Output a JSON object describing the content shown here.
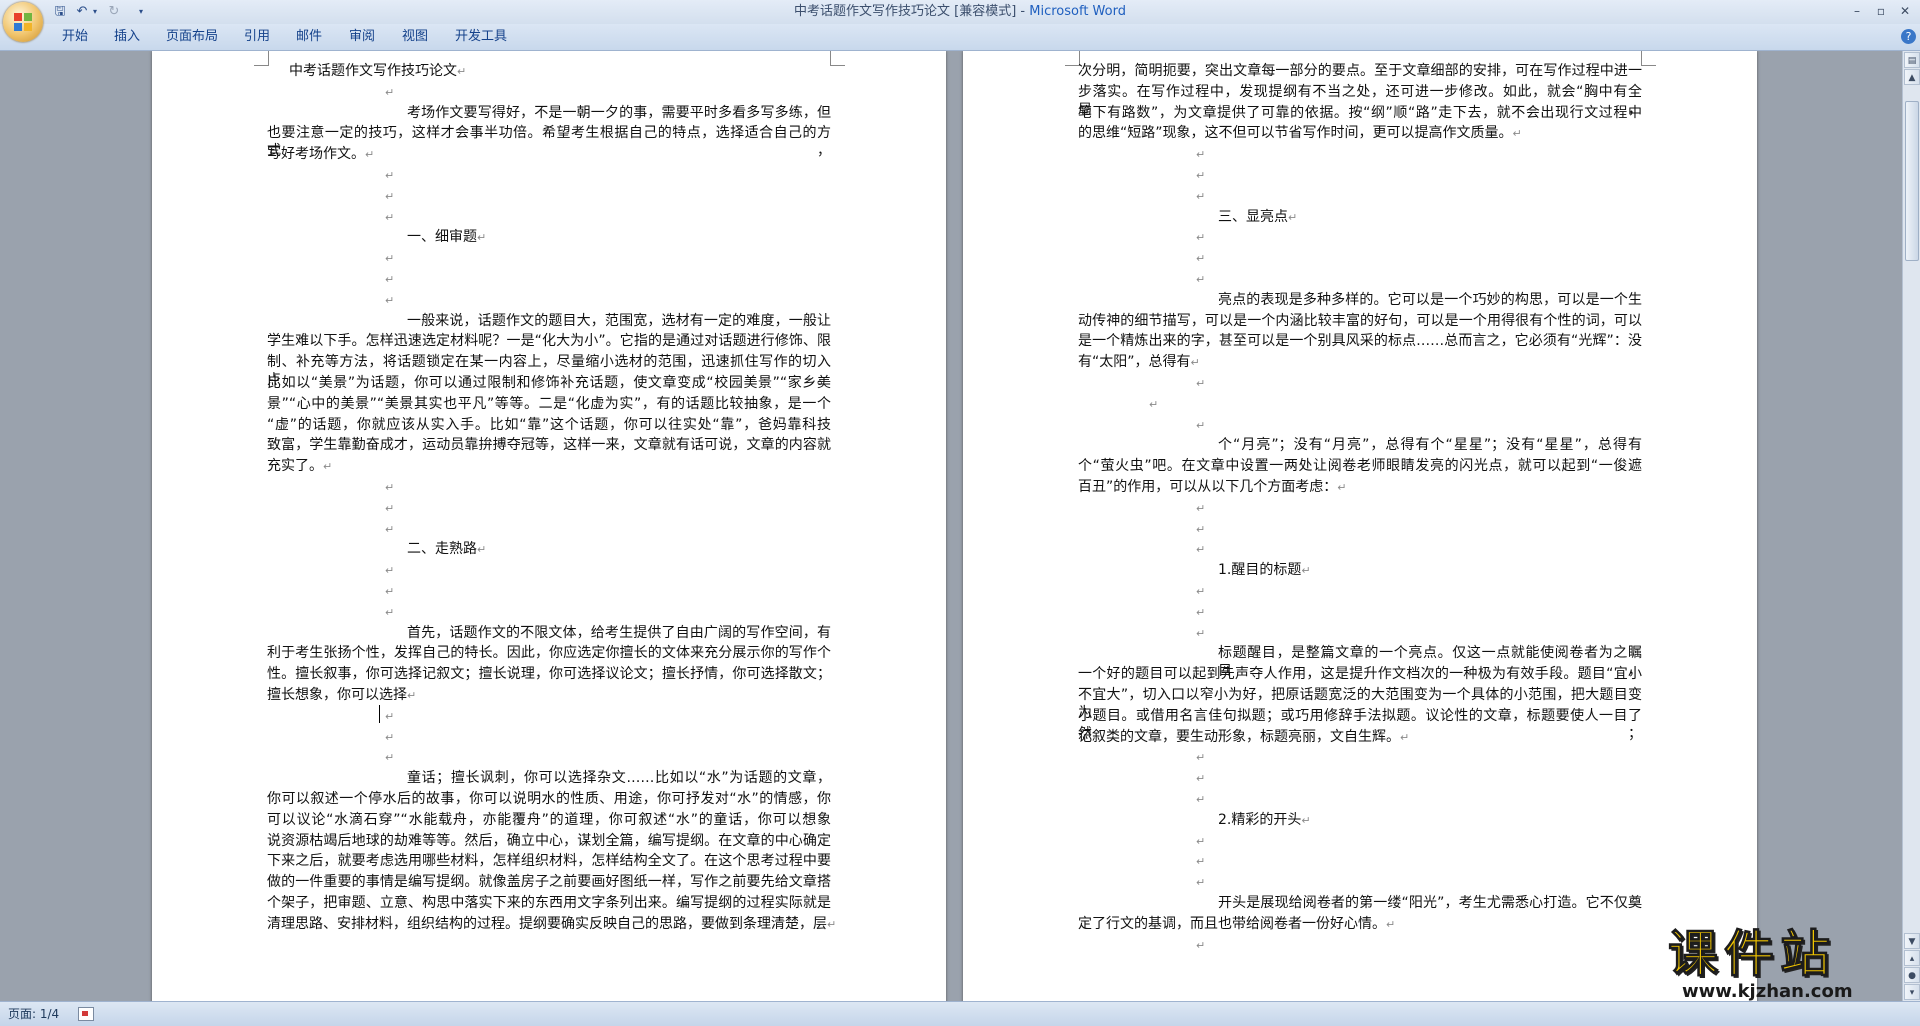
{
  "window": {
    "title_doc": "中考话题作文写作技巧论文 [兼容模式]",
    "title_separator": " - ",
    "title_app": "Microsoft Word"
  },
  "quick_access": {
    "icons": [
      "save-icon",
      "undo-icon",
      "undo-dropdown-icon",
      "redo-icon",
      "customize-qat-icon"
    ]
  },
  "ribbon": {
    "tabs": [
      "开始",
      "插入",
      "页面布局",
      "引用",
      "邮件",
      "审阅",
      "视图",
      "开发工具"
    ]
  },
  "pilcrow": "↵",
  "left_page": [
    {
      "type": "title",
      "text": "中考话题作文写作技巧论文"
    },
    {
      "type": "empty"
    },
    {
      "type": "para",
      "lines": [
        "考场作文要写得好，不是一朝一夕的事，需要平时多看多写多练，但",
        "也要注意一定的技巧，这样才会事半功倍。希望考生根据自己的特点，选择适合自己的方式，",
        "写好考场作文。"
      ]
    },
    {
      "type": "empty"
    },
    {
      "type": "empty"
    },
    {
      "type": "empty"
    },
    {
      "type": "heading",
      "text": "一、细审题"
    },
    {
      "type": "empty"
    },
    {
      "type": "empty"
    },
    {
      "type": "empty"
    },
    {
      "type": "para",
      "lines": [
        "一般来说，话题作文的题目大，范围宽，选材有一定的难度，一般让",
        "学生难以下手。怎样迅速选定材料呢？一是“化大为小”。它指的是通过对话题进行修饰、限",
        "制、补充等方法，将话题锁定在某一内容上，尽量缩小选材的范围，迅速抓住写作的切入点。",
        "比如以“美景”为话题，你可以通过限制和修饰补充话题，使文章变成“校园美景”“家乡美",
        "景”“心中的美景”“美景其实也平凡”等等。二是“化虚为实”，有的话题比较抽象，是一个",
        "“虚”的话题，你就应该从实入手。比如“靠”这个话题，你可以往实处“靠”，爸妈靠科技",
        "致富，学生靠勤奋成才，运动员靠拚搏夺冠等，这样一来，文章就有话可说，文章的内容就",
        "充实了。"
      ]
    },
    {
      "type": "empty"
    },
    {
      "type": "empty"
    },
    {
      "type": "empty"
    },
    {
      "type": "heading",
      "text": "二、走熟路"
    },
    {
      "type": "empty"
    },
    {
      "type": "empty"
    },
    {
      "type": "empty"
    },
    {
      "type": "para",
      "lines": [
        "首先，话题作文的不限文体，给考生提供了自由广阔的写作空间，有",
        "利于考生张扬个性，发挥自己的特长。因此，你应选定你擅长的文体来充分展示你的写作个",
        "性。擅长叙事，你可选择记叙文；擅长说理，你可选择议论文；擅长抒情，你可选择散文；",
        "擅长想象，你可以选择"
      ]
    },
    {
      "type": "empty",
      "cursor": true
    },
    {
      "type": "empty"
    },
    {
      "type": "empty"
    },
    {
      "type": "para",
      "lines": [
        "童话；擅长讽刺，你可以选择杂文……比如以“水”为话题的文章，",
        "你可以叙述一个停水后的故事，你可以说明水的性质、用途，你可抒发对“水”的情感，你",
        "可以议论“水滴石穿”“水能载舟，亦能覆舟”的道理，你可叙述“水”的童话，你可以想象",
        "说资源枯竭后地球的劫难等等。然后，确立中心，谋划全篇，编写提纲。在文章的中心确定",
        "下来之后，就要考虑选用哪些材料，怎样组织材料，怎样结构全文了。在这个思考过程中要",
        "做的一件重要的事情是编写提纲。就像盖房子之前要画好图纸一样，写作之前要先给文章搭",
        "个架子，把审题、立意、构思中落实下来的东西用文字条列出来。编写提纲的过程实际就是",
        "清理思路、安排材料，组织结构的过程。提纲要确实反映自己的思路，要做到条理清楚，层"
      ]
    }
  ],
  "right_page": [
    {
      "type": "para",
      "cont": true,
      "lines": [
        "次分明，简明扼要，突出文章每一部分的要点。至于文章细部的安排，可在写作过程中进一",
        "步落实。在写作过程中，发现提纲有不当之处，还可进一步修改。如此，就会“胸中有全局，",
        "笔下有路数”，为文章提供了可靠的依据。按“纲”顺“路”走下去，就不会出现行文过程中",
        "的思维“短路”现象，这不但可以节省写作时间，更可以提高作文质量。"
      ]
    },
    {
      "type": "empty"
    },
    {
      "type": "empty"
    },
    {
      "type": "empty"
    },
    {
      "type": "heading",
      "text": "三、显亮点"
    },
    {
      "type": "empty"
    },
    {
      "type": "empty"
    },
    {
      "type": "empty"
    },
    {
      "type": "para",
      "lines": [
        "亮点的表现是多种多样的。它可以是一个巧妙的构思，可以是一个生",
        "动传神的细节描写，可以是一个内涵比较丰富的好句，可以是一个用得很有个性的词，可以",
        "是一个精炼出来的字，甚至可以是一个别具风采的标点……总而言之，它必须有“光辉”：没",
        "有“太阳”，总得有"
      ]
    },
    {
      "type": "empty"
    },
    {
      "type": "empty",
      "indent": "small"
    },
    {
      "type": "empty"
    },
    {
      "type": "para",
      "lines": [
        "个“月亮”；没有“月亮”，总得有个“星星”；没有“星星”，总得有",
        "个“萤火虫”吧。在文章中设置一两处让阅卷老师眼睛发亮的闪光点，就可以起到“一俊遮",
        "百丑”的作用，可以从以下几个方面考虑："
      ]
    },
    {
      "type": "empty"
    },
    {
      "type": "empty"
    },
    {
      "type": "empty"
    },
    {
      "type": "heading",
      "text": "1.醒目的标题"
    },
    {
      "type": "empty"
    },
    {
      "type": "empty"
    },
    {
      "type": "empty"
    },
    {
      "type": "para",
      "lines": [
        "标题醒目，是整篇文章的一个亮点。仅这一点就能使阅卷者为之瞩目，",
        "一个好的题目可以起到先声夺人作用，这是提升作文档次的一种极为有效手段。题目“宜小",
        "不宜大”，切入口以窄小为好，把原话题宽泛的大范围变为一个具体的小范围，把大题目变为",
        "小题目。或借用名言佳句拟题；或巧用修辞手法拟题。议论性的文章，标题要使人一目了然；",
        "记叙类的文章，要生动形象，标题亮丽，文自生辉。"
      ]
    },
    {
      "type": "empty"
    },
    {
      "type": "empty"
    },
    {
      "type": "empty"
    },
    {
      "type": "heading",
      "text": "2.精彩的开头"
    },
    {
      "type": "empty"
    },
    {
      "type": "empty"
    },
    {
      "type": "empty"
    },
    {
      "type": "para",
      "lines": [
        "开头是展现给阅卷者的第一缕“阳光”，考生尤需悉心打造。它不仅奠",
        "定了行文的基调，而且也带给阅卷者一份好心情。"
      ]
    },
    {
      "type": "empty"
    }
  ],
  "statusbar": {
    "page_label": "页面: 1/4"
  },
  "watermark": {
    "main": "课件站",
    "url": "www.kjzhan.com"
  }
}
